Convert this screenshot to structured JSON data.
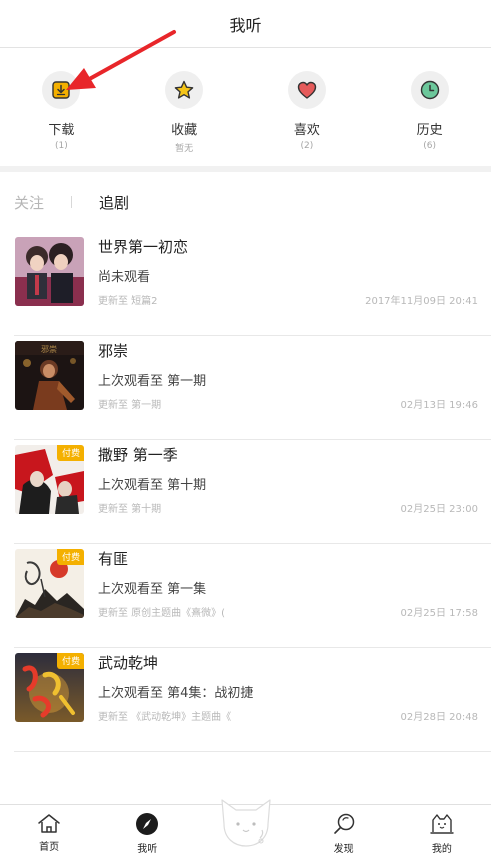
{
  "header": {
    "title": "我听"
  },
  "quick_actions": [
    {
      "label": "下载",
      "count": "(1)",
      "icon": "download-icon"
    },
    {
      "label": "收藏",
      "count": "暂无",
      "icon": "star-icon"
    },
    {
      "label": "喜欢",
      "count": "(2)",
      "icon": "heart-icon"
    },
    {
      "label": "历史",
      "count": "(6)",
      "icon": "clock-icon"
    }
  ],
  "tabs": {
    "follow": "关注",
    "chase": "追剧"
  },
  "badge_label": "付费",
  "items": [
    {
      "title": "世界第一初恋",
      "status": "尚未观看",
      "update": "更新至 短篇2",
      "date": "2017年11月09日 20:41",
      "paid": false
    },
    {
      "title": "邪崇",
      "status": "上次观看至 第一期",
      "update": "更新至 第一期",
      "date": "02月13日 19:46",
      "paid": false
    },
    {
      "title": "撒野 第一季",
      "status": "上次观看至 第十期",
      "update": "更新至 第十期",
      "date": "02月25日 23:00",
      "paid": true
    },
    {
      "title": "有匪",
      "status": "上次观看至 第一集",
      "update": "更新至 原创主题曲《熹微》(",
      "date": "02月25日 17:58",
      "paid": true
    },
    {
      "title": "武动乾坤",
      "status": "上次观看至 第4集：战初捷",
      "update": "更新至 《武动乾坤》主题曲《",
      "date": "02月28日 20:48",
      "paid": true
    }
  ],
  "tabbar": [
    {
      "label": "首页",
      "icon": "home-icon"
    },
    {
      "label": "我听",
      "icon": "compass-icon"
    },
    {
      "label": "",
      "icon": "cat-mascot-icon"
    },
    {
      "label": "发现",
      "icon": "discover-search-icon"
    },
    {
      "label": "我的",
      "icon": "profile-cat-icon"
    }
  ],
  "colors": {
    "accent_yellow": "#f4b000",
    "heart": "#e55b5b",
    "clock": "#3fa57a",
    "arrow": "#e8262a"
  }
}
